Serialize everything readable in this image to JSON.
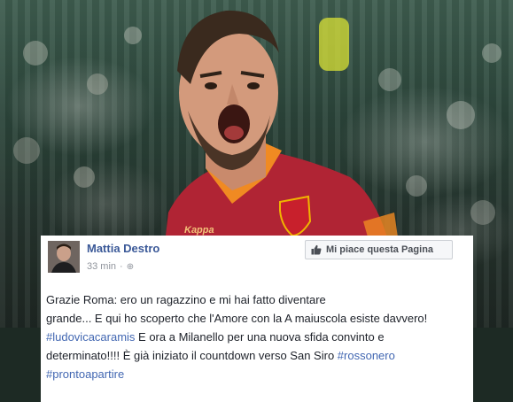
{
  "author": {
    "name": "Mattia Destro",
    "time": "33 min"
  },
  "page_like_button": {
    "label": "Mi piace questa Pagina"
  },
  "post": {
    "line1": "Grazie Roma: ero un ragazzino e mi hai fatto diventare",
    "line2": "grande... E qui ho scoperto che l'Amore con la A maiuscola esiste davvero!",
    "hashtag1": "#ludovicacaramis",
    "line3_rest": " E ora a Milanello per una nuova sfida convinto e",
    "line4": "determinato!!!! È già iniziato il countdown verso San Siro ",
    "hashtag2": "#rossonero",
    "hashtag3": "#prontoapartire"
  },
  "jersey": {
    "brand": "Kappa"
  },
  "icons": {
    "privacy": "globe-icon",
    "like": "thumbs-up-icon"
  },
  "colors": {
    "link": "#3b5998",
    "jersey": "#b02434",
    "collar": "#f08a22"
  }
}
